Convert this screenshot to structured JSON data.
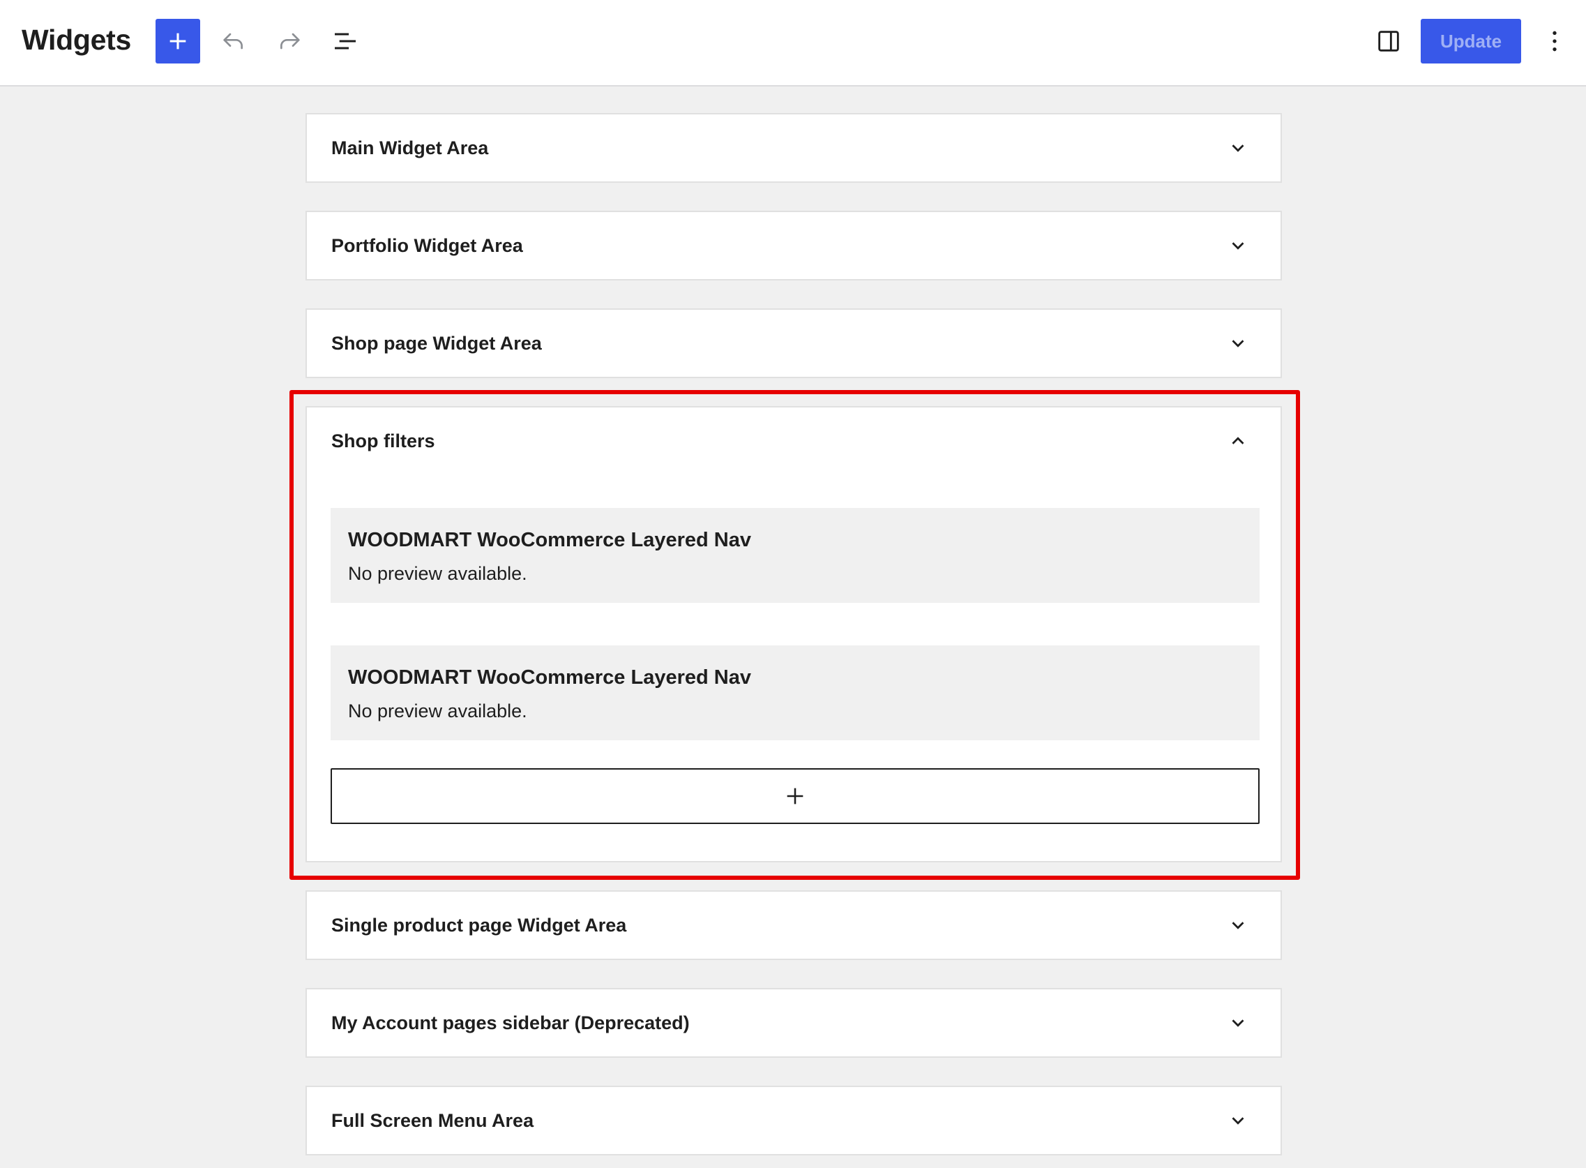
{
  "header": {
    "title": "Widgets",
    "update_label": "Update"
  },
  "icons": {
    "inserter": "plus-icon",
    "undo": "undo-icon",
    "redo": "redo-icon",
    "list_view": "list-view-icon",
    "settings_panel": "sidebar-panel-icon",
    "more": "more-vertical-icon"
  },
  "colors": {
    "accent": "#3858e9",
    "highlight": "#e60000",
    "background": "#f0f0f0"
  },
  "areas": [
    {
      "title": "Main Widget Area",
      "expanded": false
    },
    {
      "title": "Portfolio Widget Area",
      "expanded": false
    },
    {
      "title": "Shop page Widget Area",
      "expanded": false
    },
    {
      "title": "Shop filters",
      "expanded": true,
      "widgets": [
        {
          "title": "WOODMART WooCommerce Layered Nav",
          "preview": "No preview available."
        },
        {
          "title": "WOODMART WooCommerce Layered Nav",
          "preview": "No preview available."
        }
      ]
    },
    {
      "title": "Single product page Widget Area",
      "expanded": false
    },
    {
      "title": "My Account pages sidebar (Deprecated)",
      "expanded": false
    },
    {
      "title": "Full Screen Menu Area",
      "expanded": false
    }
  ]
}
